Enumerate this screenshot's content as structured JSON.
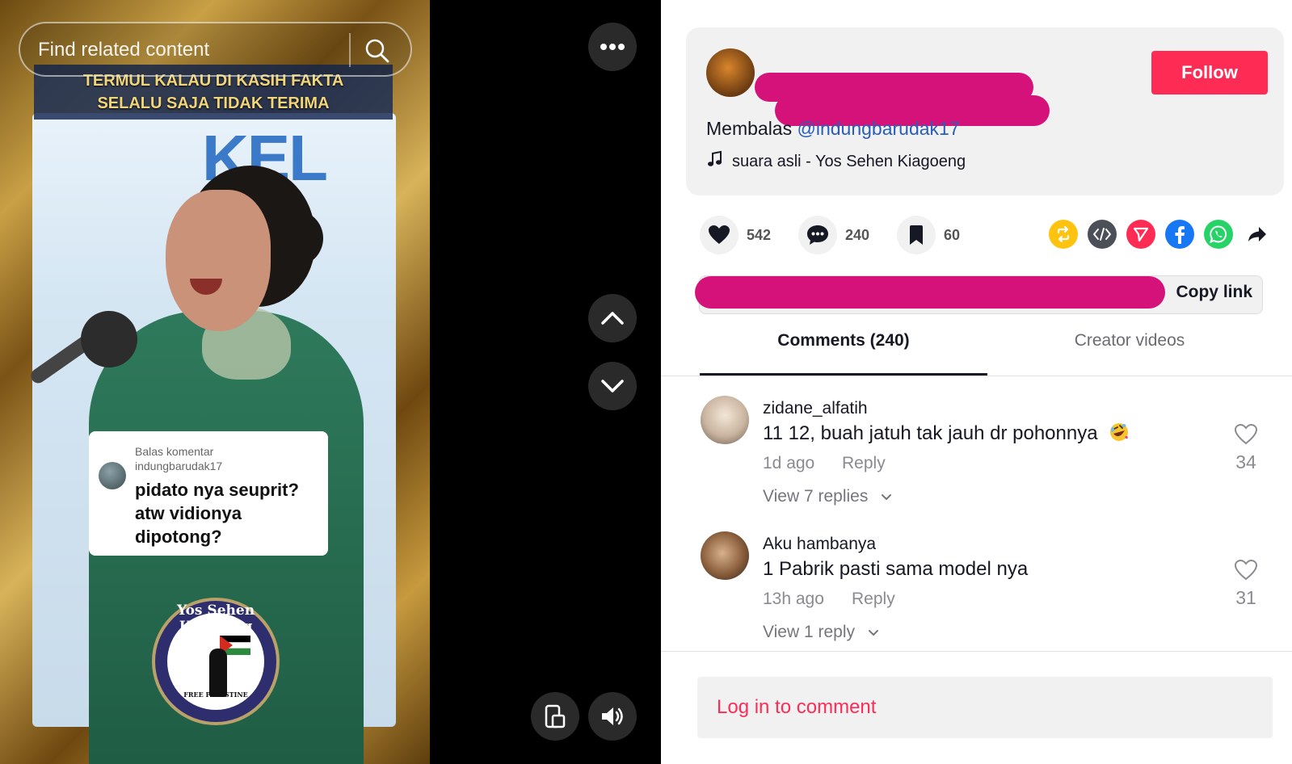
{
  "video": {
    "search": {
      "placeholder": "Find related content"
    },
    "banner": {
      "line1": "TERMUL KALAU DI KASIH FAKTA",
      "line2": "SELALU SAJA TIDAK TERIMA"
    },
    "background_text": "KEL",
    "reply_card": {
      "label": "Balas komentar",
      "username": "indungbarudak17",
      "text": "pidato nya seuprit? atw vidionya dipotong?"
    },
    "logo": {
      "title": "Yos Sehen Kiagoeng",
      "footer": "FREE PALESTINE"
    },
    "controls": [
      "more-options",
      "previous-video",
      "next-video",
      "floating-player",
      "volume"
    ]
  },
  "post": {
    "follow_label": "Follow",
    "reply_prefix": "Membalas",
    "mention": "@indungbarudak17",
    "music": "suara asli - Yos Sehen Kiagoeng",
    "likes": "542",
    "comments": "240",
    "saves": "60",
    "share_icons": [
      "repost",
      "embed",
      "send",
      "facebook",
      "whatsapp",
      "share-forward"
    ],
    "copy_link_label": "Copy link",
    "colors": {
      "accent": "#fe2c55",
      "redaction": "#d5127a",
      "mention": "#2b5db9"
    }
  },
  "tabs": [
    {
      "label": "Comments (240)",
      "active": true
    },
    {
      "label": "Creator videos",
      "active": false
    }
  ],
  "comments": [
    {
      "user": "zidane_alfatih",
      "text": "11 12, buah jatuh tak jauh dr pohonnya",
      "emoji": "rolling-on-floor-laughing",
      "time": "1d ago",
      "reply_label": "Reply",
      "view_replies": "View 7 replies",
      "likes": "34"
    },
    {
      "user": "Aku hambanya",
      "text": "1 Pabrik pasti sama model nya",
      "time": "13h ago",
      "reply_label": "Reply",
      "view_replies": "View 1 reply",
      "likes": "31"
    }
  ],
  "login_prompt": "Log in to comment"
}
